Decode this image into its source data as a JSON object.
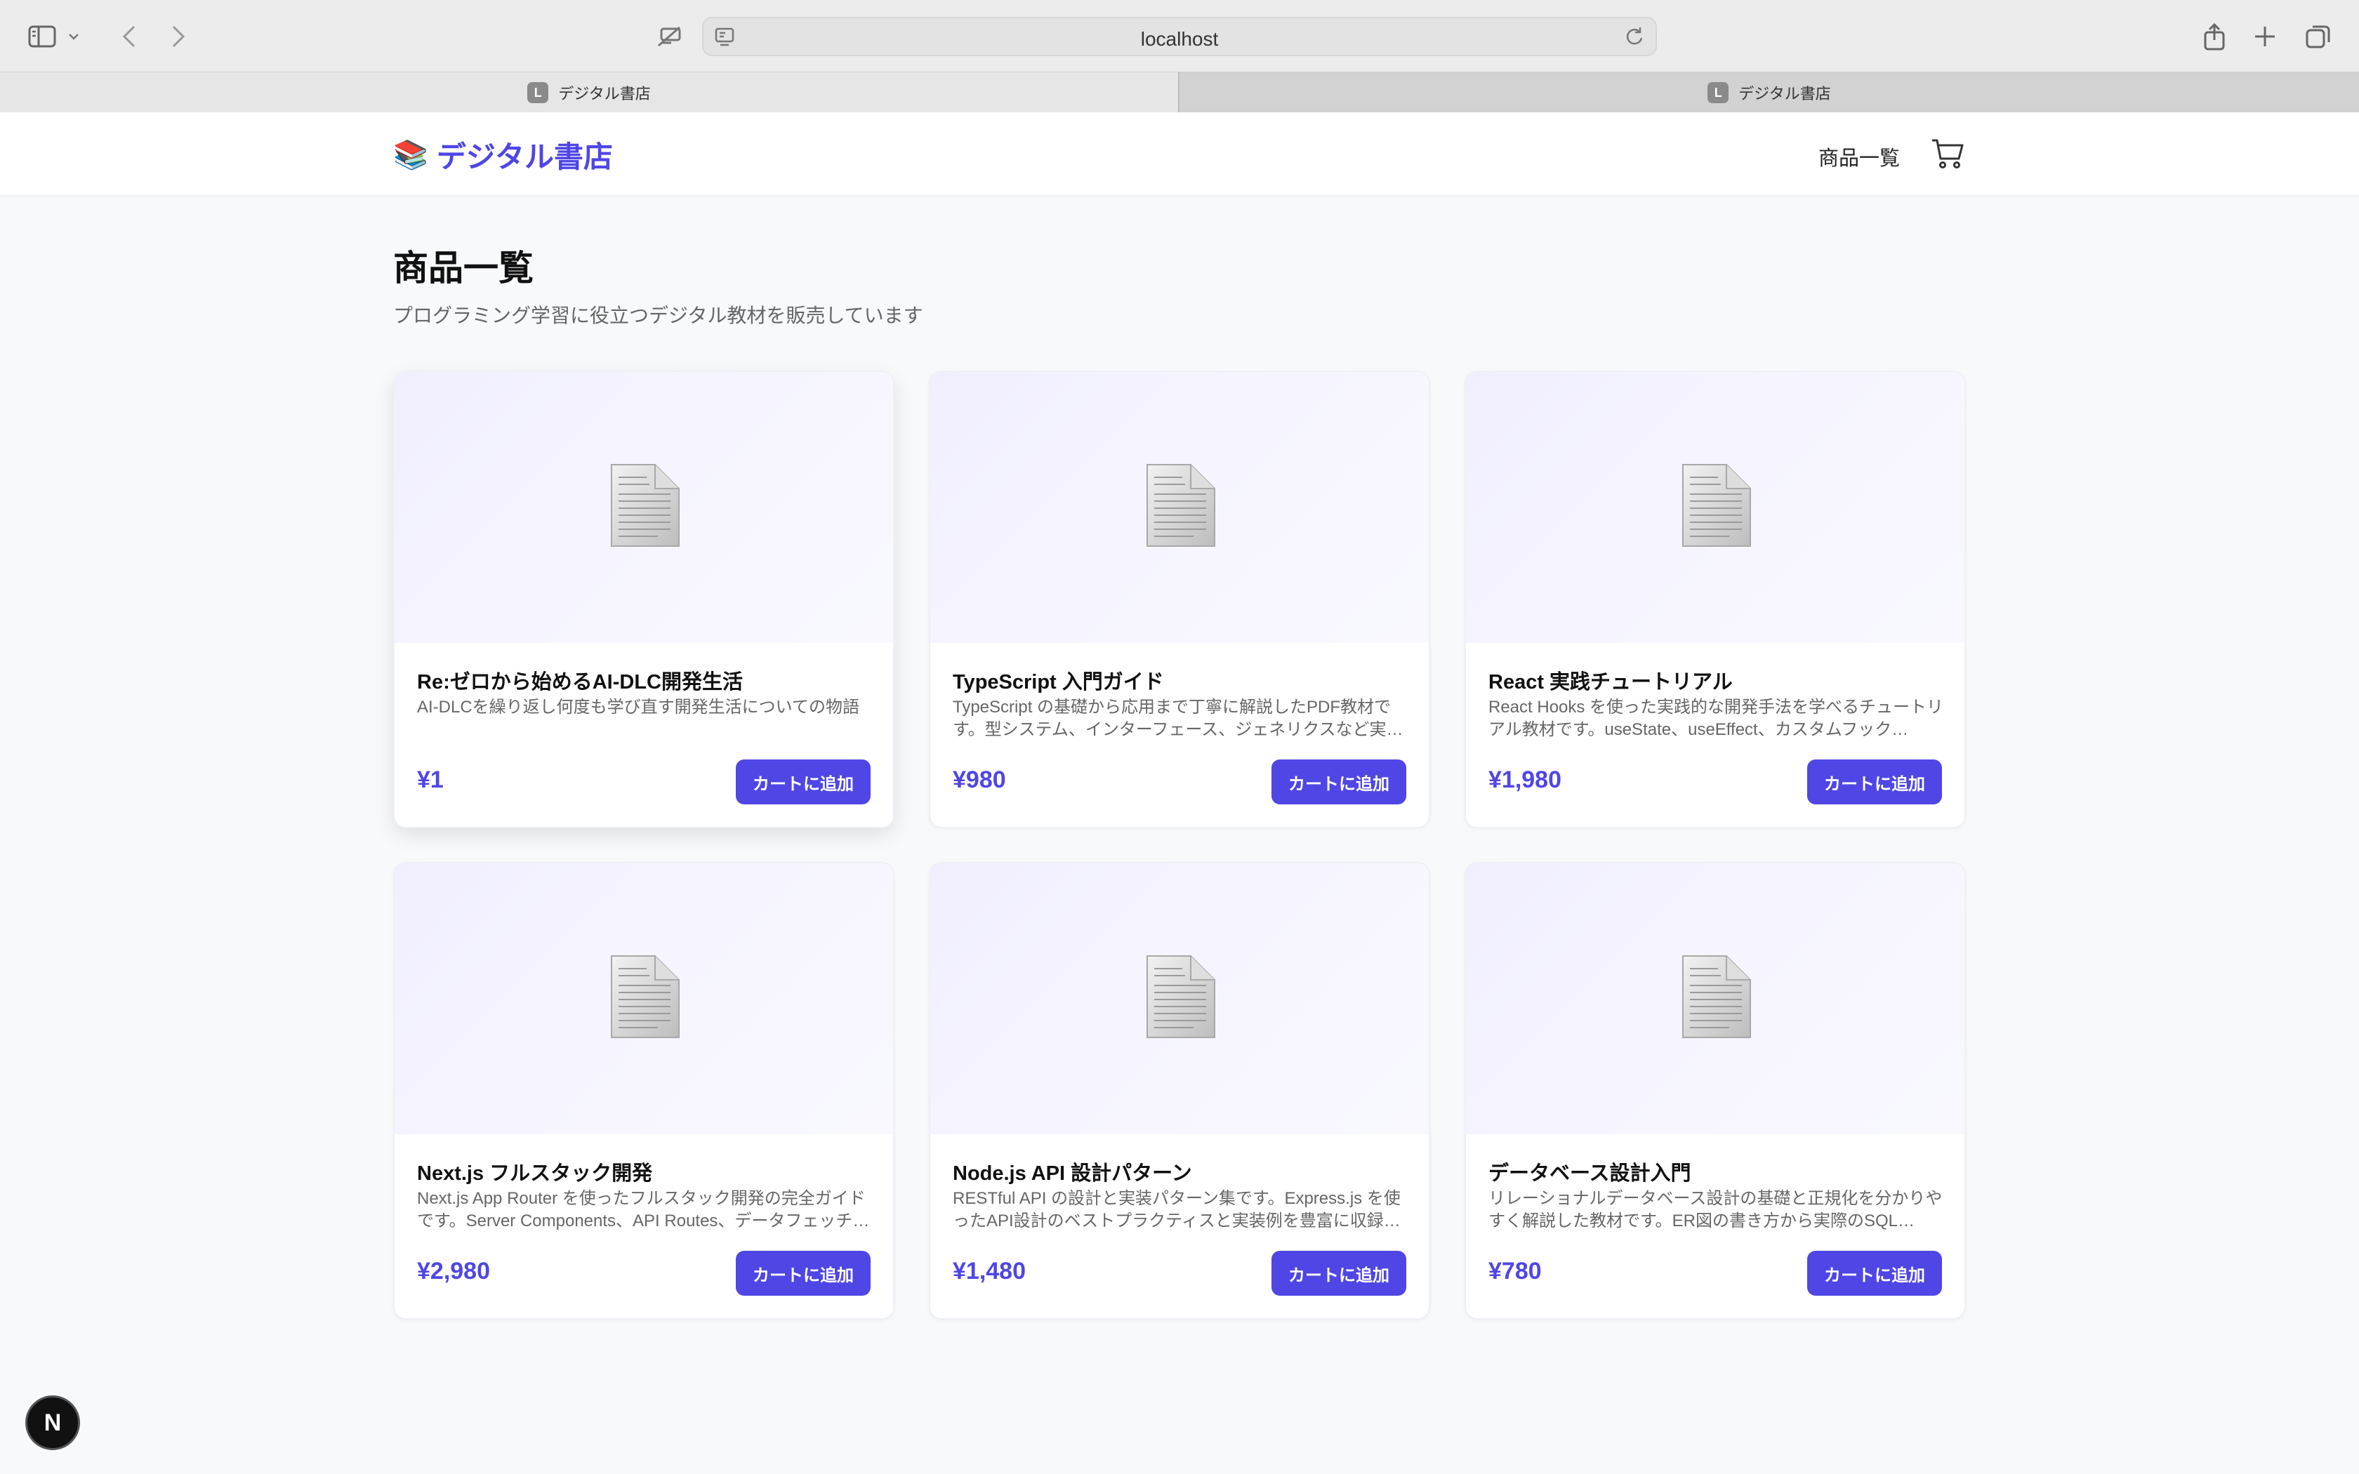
{
  "browser": {
    "url": "localhost",
    "tabs": [
      {
        "title": "デジタル書店",
        "favicon": "L",
        "active": true
      },
      {
        "title": "デジタル書店",
        "favicon": "L",
        "active": false
      }
    ]
  },
  "header": {
    "brand_icon": "📚",
    "brand_name": "デジタル書店",
    "nav_products": "商品一覧",
    "cart_icon": "cart-icon"
  },
  "main": {
    "title": "商品一覧",
    "subtitle": "プログラミング学習に役立つデジタル教材を販売しています",
    "add_to_cart_label": "カートに追加",
    "products": [
      {
        "title": "Re:ゼロから始めるAI-DLC開発生活",
        "description": "AI-DLCを繰り返し何度も学び直す開発生活についての物語",
        "price": "¥1"
      },
      {
        "title": "TypeScript 入門ガイド",
        "description": "TypeScript の基礎から応用まで丁寧に解説したPDF教材です。型システム、インターフェース、ジェネリクスなど実…",
        "price": "¥980"
      },
      {
        "title": "React 実践チュートリアル",
        "description": "React Hooks を使った実践的な開発手法を学べるチュートリアル教材です。useState、useEffect、カスタムフック…",
        "price": "¥1,980"
      },
      {
        "title": "Next.js フルスタック開発",
        "description": "Next.js App Router を使ったフルスタック開発の完全ガイドです。Server Components、API Routes、データフェッチ…",
        "price": "¥2,980"
      },
      {
        "title": "Node.js API 設計パターン",
        "description": "RESTful API の設計と実装パターン集です。Express.js を使ったAPI設計のベストプラクティスと実装例を豊富に収録…",
        "price": "¥1,480"
      },
      {
        "title": "データベース設計入門",
        "description": "リレーショナルデータベース設計の基礎と正規化を分かりやすく解説した教材です。ER図の書き方から実際のSQL…",
        "price": "¥780"
      }
    ]
  },
  "dev_badge": "N",
  "colors": {
    "accent": "#4f46e5",
    "background": "#f8f9fb"
  }
}
